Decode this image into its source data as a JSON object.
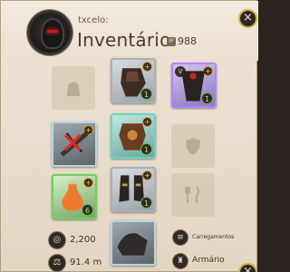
{
  "header": {
    "username": "txcelo:",
    "title": "Inventário",
    "ip_icon": "IP",
    "item_power": "988",
    "close_icon": "×"
  },
  "slots": {
    "bag": {
      "tier": "",
      "ench": "+",
      "qty": "1"
    },
    "head": {
      "tier": "",
      "ench": "+",
      "qty": "1"
    },
    "cape": {
      "tier": "V",
      "ench": "+",
      "qty": "1"
    },
    "mainhand": {
      "tier": "",
      "ench": "+",
      "qty": ""
    },
    "armor": {
      "tier": "",
      "ench": "+",
      "qty": "1"
    },
    "offhand_broken_mark": "✕",
    "potion": {
      "tier": "",
      "ench": "+",
      "qty": "6"
    },
    "shoes": {
      "tier": "",
      "ench": "+",
      "qty": "1"
    },
    "mount": {
      "tier": "",
      "ench": "",
      "qty": ""
    }
  },
  "stats": {
    "silver_value": "2,200",
    "weight_value": "91.4 m"
  },
  "links": {
    "loadouts_label": "Carregamentos",
    "wardrobe_label": "Armário"
  },
  "colors": {
    "panel_bg": "#ebdfce",
    "text": "#4a3c34",
    "close_ring": "#d0b03a",
    "broken_red": "#e1291f"
  }
}
